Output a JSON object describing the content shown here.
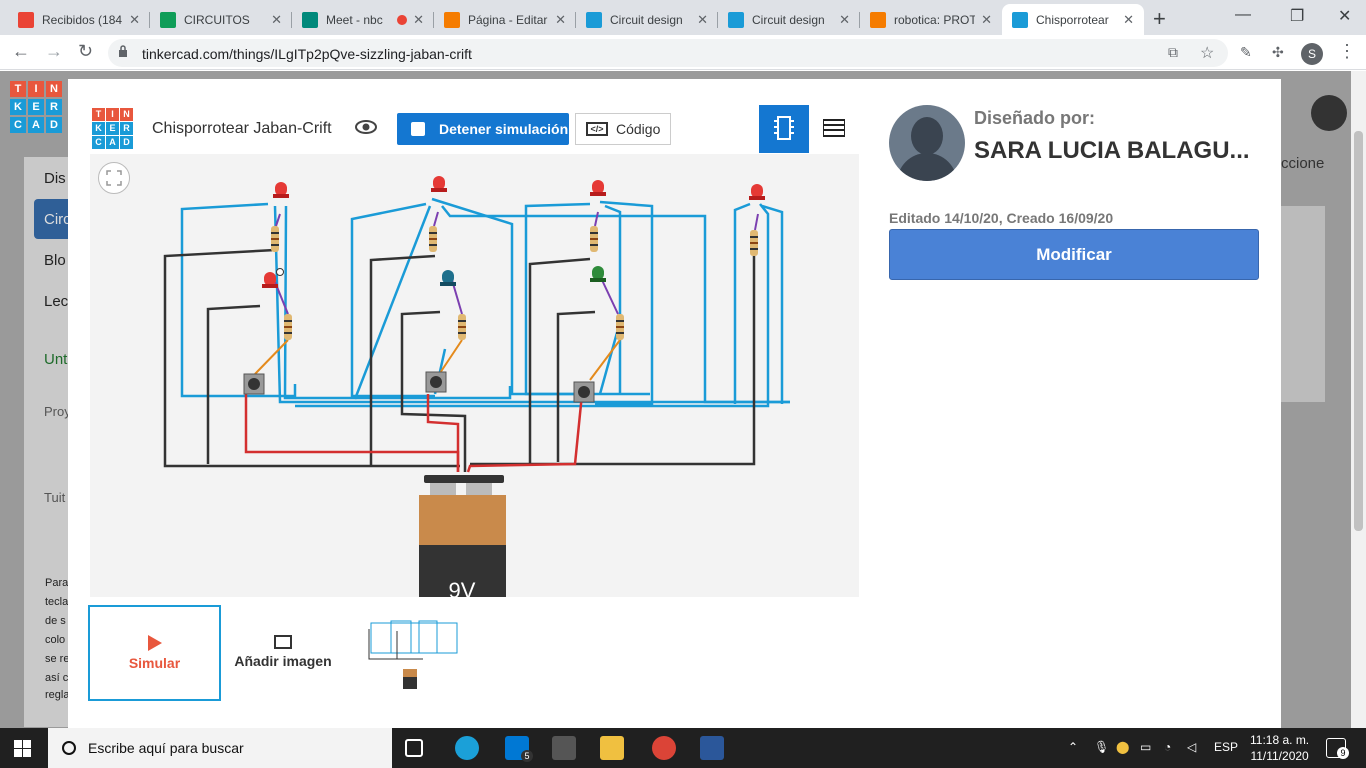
{
  "browser": {
    "tabs": [
      {
        "title": "Recibidos (184",
        "color": "#ea4335"
      },
      {
        "title": "CIRCUITOS",
        "color": "#0f9d58"
      },
      {
        "title": "Meet - nbc",
        "color": "#00897b"
      },
      {
        "title": "Página - Editar",
        "color": "#f57c00"
      },
      {
        "title": "Circuit design",
        "color": "#1a9bd7"
      },
      {
        "title": "Circuit design",
        "color": "#1a9bd7"
      },
      {
        "title": "robotica: PROT",
        "color": "#f57c00"
      },
      {
        "title": "Chisporrotear",
        "color": "#1a9bd7"
      }
    ],
    "url": "tinkercad.com/things/ILgITp2pQve-sizzling-jaban-crift",
    "profile_initial": "S"
  },
  "underlay": {
    "items": [
      "Dis",
      "Circ",
      "Blo",
      "Lec",
      "Unt",
      "Proy",
      "Tuit",
      "Para",
      "tecla",
      "de s",
      "colo",
      "se re",
      "así c",
      "regla",
      "ccione"
    ]
  },
  "project": {
    "title": "Chisporrotear Jaban-Crift",
    "stop_label": "Detener simulación",
    "code_label": "Código",
    "code_icon_text": "</>",
    "logo": [
      "T",
      "I",
      "N",
      "K",
      "E",
      "R",
      "C",
      "A",
      "D"
    ]
  },
  "circuit": {
    "battery_label": "9V",
    "led_colors": [
      "#e53935",
      "#e53935",
      "#e53935",
      "#e53935",
      "#e53935",
      "#1e6f8c",
      "#2e8b3a"
    ]
  },
  "thumbs": {
    "simulate_label": "Simular",
    "add_image_label": "Añadir imagen"
  },
  "designer": {
    "designed_by": "Diseñado por:",
    "name": "SARA LUCIA BALAGU...",
    "dates": "Editado 14/10/20, Creado 16/09/20",
    "modify_label": "Modificar"
  },
  "taskbar": {
    "search_placeholder": "Escribe aquí para buscar",
    "lang": "ESP",
    "time": "11:18 a. m.",
    "date": "11/11/2020",
    "mail_badge": "5",
    "notif_badge": "9"
  }
}
